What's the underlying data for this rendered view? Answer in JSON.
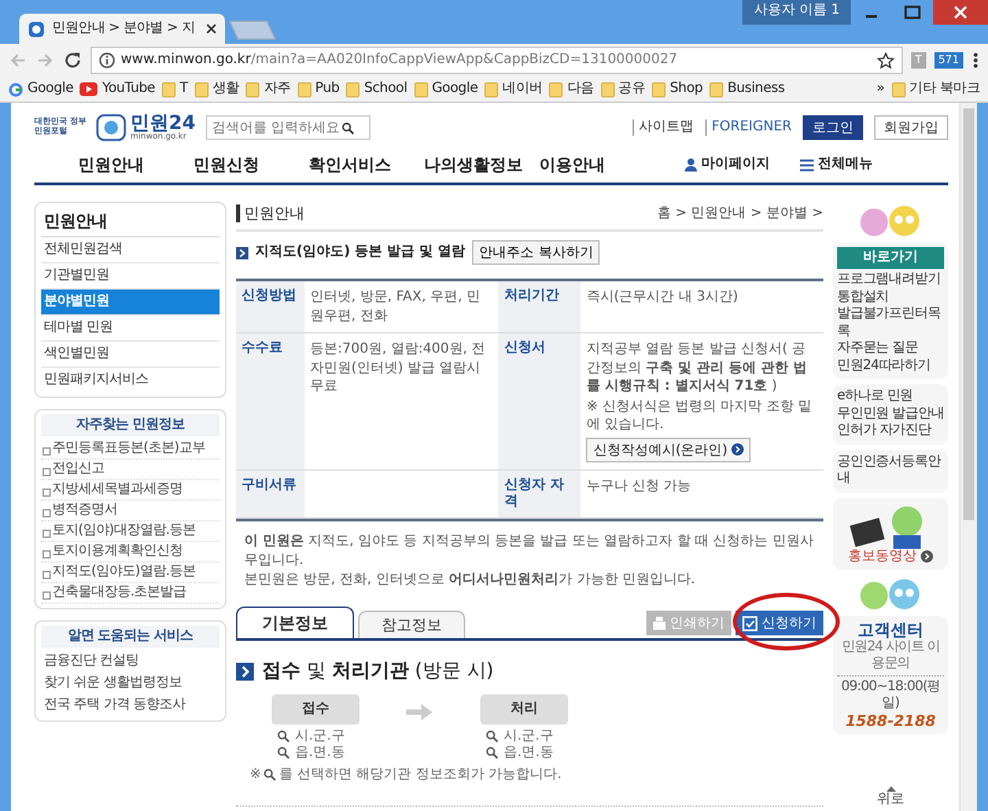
{
  "browser": {
    "tab_title": "민원안내 > 분야별 > 지",
    "user_label": "사용자 이름 1",
    "url_host": "www.minwon.go.kr",
    "url_path": "/main?a=AA020InfoCappViewApp&CappBizCD=13100000027",
    "extensions": [
      {
        "label": "T",
        "kind": "gray"
      },
      {
        "label": "571",
        "kind": "blue"
      }
    ],
    "bookmarks": [
      {
        "label": "Google",
        "kind": "site"
      },
      {
        "label": "YouTube",
        "kind": "video"
      },
      {
        "label": "T",
        "kind": "folder"
      },
      {
        "label": "생활",
        "kind": "folder"
      },
      {
        "label": "자주",
        "kind": "folder"
      },
      {
        "label": "Pub",
        "kind": "folder"
      },
      {
        "label": "School",
        "kind": "folder"
      },
      {
        "label": "Google",
        "kind": "folder"
      },
      {
        "label": "네이버",
        "kind": "folder"
      },
      {
        "label": "다음",
        "kind": "folder"
      },
      {
        "label": "공유",
        "kind": "folder"
      },
      {
        "label": "Shop",
        "kind": "folder"
      },
      {
        "label": "Business",
        "kind": "folder"
      }
    ],
    "overflow": "»",
    "other_bookmarks": "기타 북마크"
  },
  "header": {
    "logo_small": "대한민국 정부민원포털",
    "logo_text": "민원24",
    "logo_sub": "minwon.go.kr",
    "search_placeholder": "검색어를 입력하세요",
    "links": [
      "사이트맵",
      "FOREIGNER"
    ],
    "login": "로그인",
    "join": "회원가입"
  },
  "nav": {
    "items": [
      "민원안내",
      "민원신청",
      "확인서비스",
      "나의생활정보",
      "이용안내"
    ],
    "mypage": "마이페이지",
    "all_menu": "전체메뉴"
  },
  "sidebar": {
    "title": "민원안내",
    "items": [
      {
        "label": "전체민원검색",
        "selected": false
      },
      {
        "label": "기관별민원",
        "selected": false
      },
      {
        "label": "분야별민원",
        "selected": true
      },
      {
        "label": "테마별 민원",
        "selected": false
      },
      {
        "label": "색인별민원",
        "selected": false
      },
      {
        "label": "민원패키지서비스",
        "selected": false
      }
    ]
  },
  "frequent": {
    "title": "자주찾는 민원정보",
    "items": [
      "주민등록표등본(초본)교부",
      "전입신고",
      "지방세세목별과세증명",
      "병적증명서",
      "토지(임야)대장열람.등본",
      "토지이용계획확인신청",
      "지적도(임야도)열람.등본",
      "건축물대장등.초본발급"
    ]
  },
  "helpful": {
    "title": "알면 도움되는 서비스",
    "items": [
      "금융진단 컨설팅",
      "찾기 쉬운 생활법령정보",
      "전국 주택 가격 동향조사"
    ]
  },
  "main": {
    "section": "민원안내",
    "breadcrumb": "홈 > 민원안내 > 분야별 >",
    "title": "지적도(임야도) 등본 발급 및 열람",
    "copy_button": "안내주소 복사하기",
    "table": [
      {
        "cells": [
          {
            "label": "신청방법",
            "value": "인터넷, 방문, FAX, 우편, 민원우편, 전화"
          },
          {
            "label": "처리기간",
            "value": "즉시(근무시간 내 3시간)"
          }
        ]
      },
      {
        "cells": [
          {
            "label": "수수료",
            "value": "등본:700원, 열람:400원, 전자민원(인터넷) 발급 열람시 무료"
          },
          {
            "label": "신청서",
            "value": "지적공부 열람 등본 발급 신청서( 공간정보의 **구축 및 관리 등에 관한 법률 시행규칙 : 별지서식 71호** )",
            "note": "※ 신청서식은 법령의 마지막 조항 밑에 있습니다.",
            "button": "신청작성예시(온라인)"
          }
        ]
      },
      {
        "cells": [
          {
            "label": "구비서류"
          },
          {
            "label": "신청자 자격",
            "value": "누구나 신청 가능"
          }
        ]
      }
    ],
    "notes": [
      "**이 민원은** 지적도, 임야도 등 지적공부의 등본을 발급 또는 열람하고자 할 때 신청하는 민원사무입니다.",
      "본민원은 방문, 전화, 인터넷으로 **어디서나민원처리**가 가능한 민원입니다."
    ],
    "tabs": [
      {
        "label": "기본정보",
        "selected": true
      },
      {
        "label": "참고정보",
        "selected": false
      }
    ],
    "print_button": "인쇄하기",
    "apply_button": "신청하기",
    "heading": "**접수** 및 **처리기관** (방문 시)",
    "flow": [
      {
        "title": "접수",
        "links": [
          "시.군.구",
          "읍.면.동"
        ]
      },
      {
        "title": "처리",
        "links": [
          "시.군.구",
          "읍.면.동"
        ]
      }
    ],
    "flow_note_mark": "※",
    "flow_note": "를 선택하면 해당기관 정보조회가 가능합니다."
  },
  "right": {
    "quick_title": "바로가기",
    "quick_items": [
      "프로그램내려받기",
      "통합설치",
      "발급불가프린터목록",
      "자주묻는 질문",
      "민원24따라하기"
    ],
    "service_items": [
      "e하나로 민원",
      "무인민원 발급안내",
      "인허가 자가진단"
    ],
    "cert_items": [
      "공인인증서등록안내"
    ],
    "video": "홍보동영상",
    "center_title": "고객센터",
    "center_sub": "민원24 사이트 이용문의",
    "center_hours": "09:00~18:00(평일)",
    "center_phone": "1588-2188",
    "top_link": "위로"
  }
}
